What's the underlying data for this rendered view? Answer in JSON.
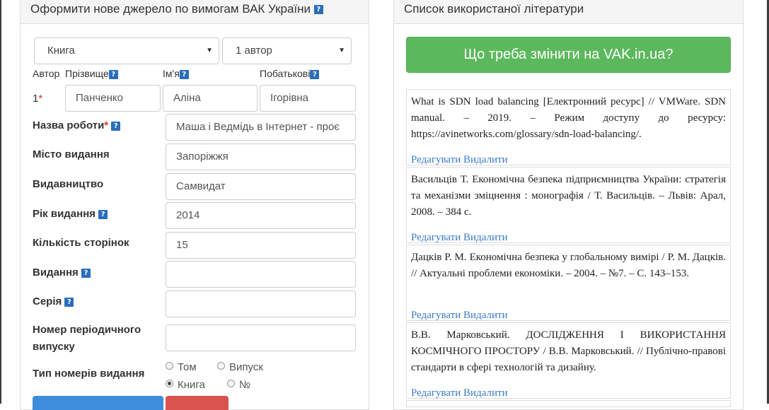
{
  "left_panel": {
    "title": "Оформити нове джерело по вимогам ВАК України",
    "type_select": "Книга",
    "authors_select": "1 автор",
    "author_header": "Автор",
    "surname_header": "Прізвище",
    "name_header": "Ім'я",
    "patronymic_header": "Побатькові",
    "author_number": "1",
    "surname_value": "Панченко",
    "name_value": "Аліна",
    "patronymic_value": "Ігорівна",
    "fields": {
      "title_label": "Назва роботи",
      "title_value": "Маша і Ведмідь в Інтернет - проє",
      "city_label": "Місто видання",
      "city_value": "Запоріжжя",
      "publisher_label": "Видавництво",
      "publisher_value": "Самвидат",
      "year_label": "Рік видання",
      "year_value": "2014",
      "pages_label": "Кількість сторінок",
      "pages_value": "15",
      "edition_label": "Видання",
      "edition_value": "",
      "series_label": "Серія",
      "series_value": "",
      "periodic_label_1": "Номер періодичного",
      "periodic_label_2": "випуску",
      "periodic_value": ""
    },
    "number_type": {
      "label": "Тип номерів видання",
      "options": [
        "Том",
        "Випуск",
        "Книга",
        "№"
      ],
      "selected": "Книга"
    },
    "help_glyph": "?",
    "required_mark": "*"
  },
  "right_panel": {
    "title": "Список використаної літератури",
    "change_button": "Що треба змінити на VAK.in.ua?",
    "edit_label": "Редагувати",
    "delete_label": "Видалити",
    "references": [
      "What is SDN load balancing [Електронний ресурс] // VMWare. SDN manual. – 2019. – Режим доступу до ресурсу: https://avinetworks.com/glossary/sdn-load-balancing/.",
      "Васильців Т. Економічна безпека підприємництва України: стратегія та механізми зміцнення : монографія / Т. Васильців. – Львів: Арал, 2008. – 384 с.",
      "Дацків Р. М. Економічна безпека у глобальному вимірі / Р. М. Дацків. // Актуальні проблеми економіки. – 2004. – №7. – С. 143–153.",
      "В.В. Марковський. ДОСЛІДЖЕННЯ І ВИКОРИСТАННЯ КОСМІЧНОГО ПРОСТОРУ / В.В. Марковський. // Публічно-правові стандарти в сфері технологій та дизайну."
    ]
  },
  "colors": {
    "accent_green": "#5cb85c",
    "link_blue": "#3a7bc8",
    "help_blue": "#2a6ebb",
    "required_red": "#d9302c",
    "button_blue": "#3c8dda",
    "button_red": "#d9534f"
  }
}
